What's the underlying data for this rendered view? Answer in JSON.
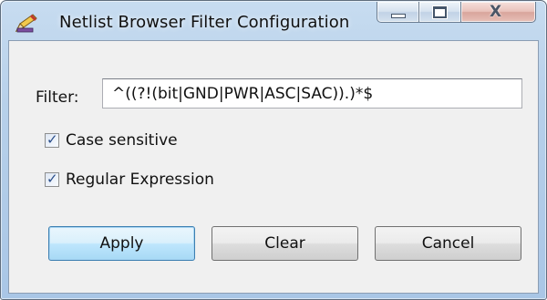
{
  "window": {
    "title": "Netlist Browser Filter Configuration",
    "controls": {
      "minimize": "minimize",
      "maximize": "maximize",
      "close_glyph": "X"
    }
  },
  "filter": {
    "label": "Filter:",
    "value": "^((?!(bit|GND|PWR|ASC|SAC)).)*$"
  },
  "options": {
    "case_sensitive": {
      "label": "Case sensitive",
      "checked": true
    },
    "regular_expression": {
      "label": "Regular Expression",
      "checked": true
    }
  },
  "buttons": {
    "apply": "Apply",
    "clear": "Clear",
    "cancel": "Cancel"
  },
  "icons": {
    "app": "pencil-ruler-icon",
    "check": "checkmark-icon"
  },
  "colors": {
    "frame": "#b7d0ea",
    "client": "#f0f0f0",
    "default_button": "#bee6fd",
    "close_button": "#e9c2bb"
  }
}
